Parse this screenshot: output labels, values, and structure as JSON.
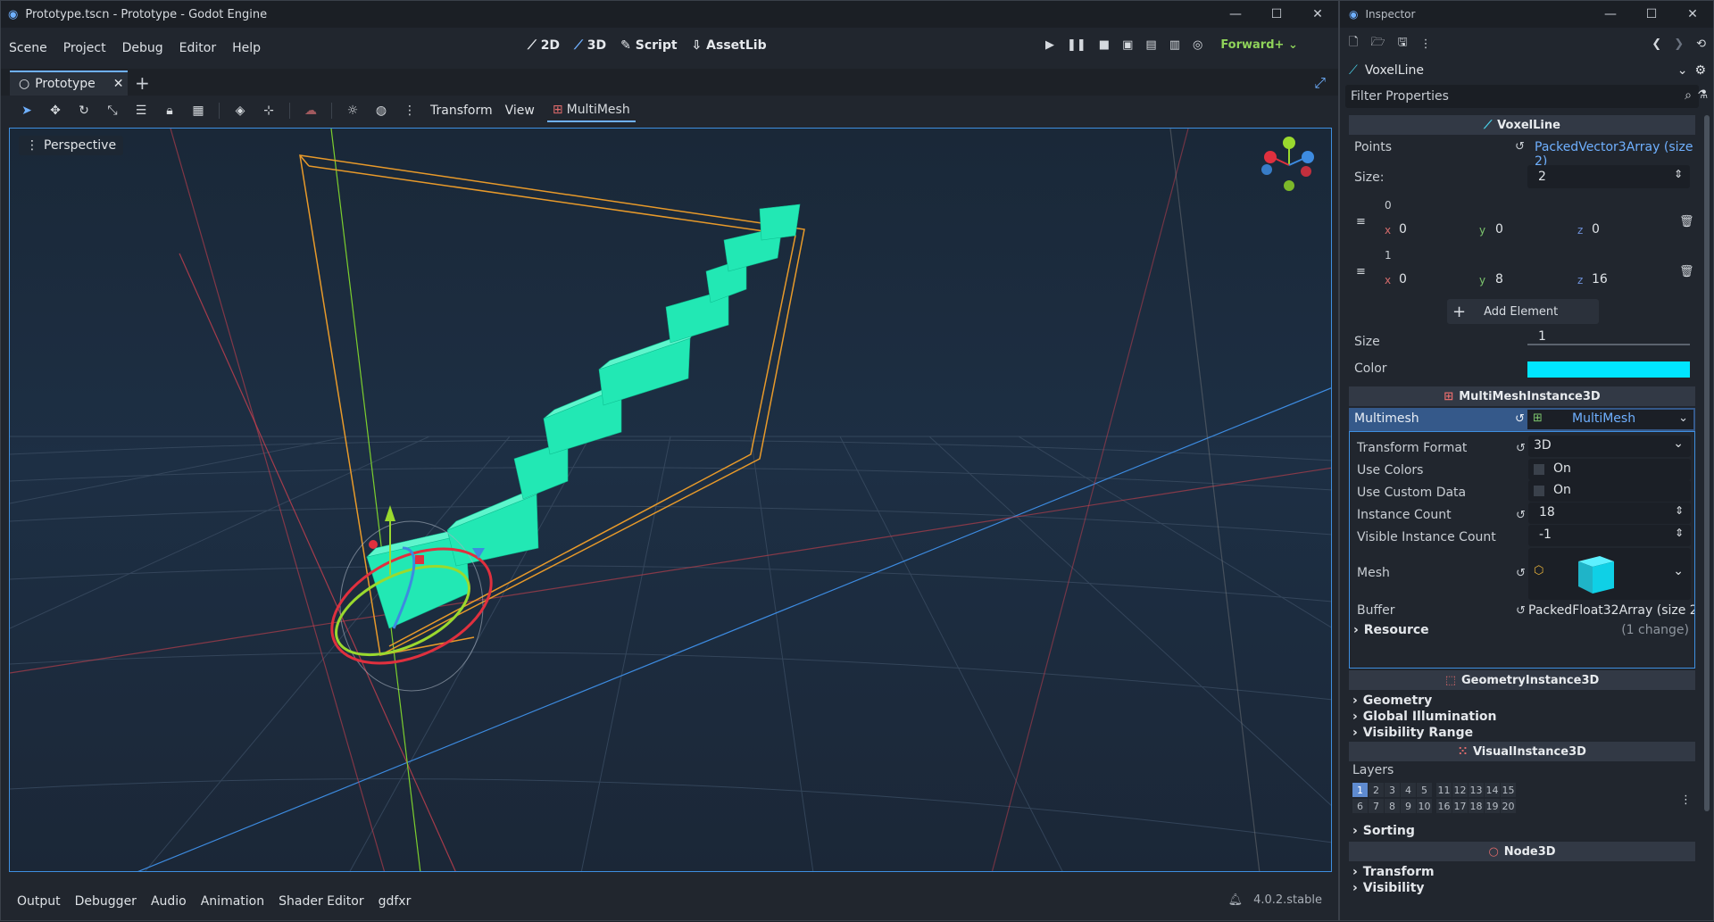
{
  "main": {
    "title": "Prototype.tscn - Prototype - Godot Engine",
    "menus": [
      "Scene",
      "Project",
      "Debug",
      "Editor",
      "Help"
    ],
    "workspaces": {
      "w2d": "2D",
      "w3d": "3D",
      "script": "Script",
      "assetlib": "AssetLib"
    },
    "renderer": "Forward+",
    "scene_tab": "Prototype",
    "toolbar": {
      "transform": "Transform",
      "view": "View",
      "multimesh": "MultiMesh"
    },
    "viewport": {
      "perspective": "Perspective"
    },
    "bottom_tabs": [
      "Output",
      "Debugger",
      "Audio",
      "Animation",
      "Shader Editor",
      "gdfxr"
    ],
    "version": "4.0.2.stable"
  },
  "inspector": {
    "title": "Inspector",
    "object_name": "VoxelLine",
    "filter_placeholder": "Filter Properties",
    "voxelline": {
      "header": "VoxelLine",
      "points_label": "Points",
      "points_value": "PackedVector3Array (size 2)",
      "size_label": "Size:",
      "size_value": "2",
      "elements": [
        {
          "index": "0",
          "x": "0",
          "y": "0",
          "z": "0"
        },
        {
          "index": "1",
          "x": "0",
          "y": "8",
          "z": "16"
        }
      ],
      "add_element": "Add Element",
      "size2_label": "Size",
      "size2_value": "1",
      "color_label": "Color",
      "color_hex": "#00e5ff"
    },
    "multimesh_instance": {
      "header": "MultiMeshInstance3D",
      "multimesh_label": "Multimesh",
      "multimesh_value": "MultiMesh",
      "transform_format_label": "Transform Format",
      "transform_format_value": "3D",
      "use_colors_label": "Use Colors",
      "use_colors_value": "On",
      "use_custom_label": "Use Custom Data",
      "use_custom_value": "On",
      "instance_count_label": "Instance Count",
      "instance_count_value": "18",
      "visible_count_label": "Visible Instance Count",
      "visible_count_value": "-1",
      "mesh_label": "Mesh",
      "buffer_label": "Buffer",
      "buffer_value": "PackedFloat32Array (size 2",
      "resource_label": "Resource",
      "resource_changes": "(1 change)"
    },
    "geometry_instance": {
      "header": "GeometryInstance3D",
      "groups": [
        "Geometry",
        "Global Illumination",
        "Visibility Range"
      ]
    },
    "visual_instance": {
      "header": "VisualInstance3D",
      "layers_label": "Layers",
      "layers_row1": [
        "1",
        "2",
        "3",
        "4",
        "5",
        "11",
        "12",
        "13",
        "14",
        "15"
      ],
      "layers_row2": [
        "6",
        "7",
        "8",
        "9",
        "10",
        "16",
        "17",
        "18",
        "19",
        "20"
      ],
      "sorting": "Sorting"
    },
    "node3d": {
      "header": "Node3D",
      "groups": [
        "Transform",
        "Visibility"
      ]
    }
  },
  "colors": {
    "accent": "#6fb0ff",
    "renderer": "#8fd35a",
    "voxel": "#22e8b4"
  }
}
